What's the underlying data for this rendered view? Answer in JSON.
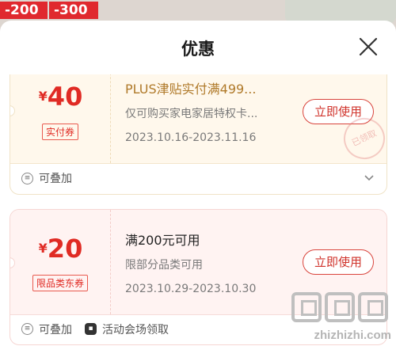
{
  "background": {
    "tag1": "-200",
    "tag2": "-300"
  },
  "sheet": {
    "title": "优惠"
  },
  "coupons": [
    {
      "currency": "¥",
      "amount": "40",
      "tag": "实付券",
      "title": "PLUS津贴实付满499...",
      "desc": "仅可购买家电家居特权卡...",
      "date": "2023.10.16-2023.11.16",
      "button": "立即使用",
      "stamp": "已领取",
      "footer": [
        {
          "icon": "stack-icon",
          "label": "可叠加"
        }
      ]
    },
    {
      "currency": "¥",
      "amount": "20",
      "tag": "限品类东券",
      "title": "满200元可用",
      "desc": "限部分品类可用",
      "date": "2023.10.29-2023.10.30",
      "button": "立即使用",
      "footer": [
        {
          "icon": "stack-icon",
          "label": "可叠加"
        },
        {
          "icon": "venue-icon",
          "label": "活动会场领取"
        }
      ]
    }
  ],
  "watermark": "zhizhizhi.com",
  "colors": {
    "accent": "#e02b24",
    "gold": "#b07a2a",
    "card1_bg": "#fff8ec",
    "card2_bg": "#fff3f2"
  }
}
